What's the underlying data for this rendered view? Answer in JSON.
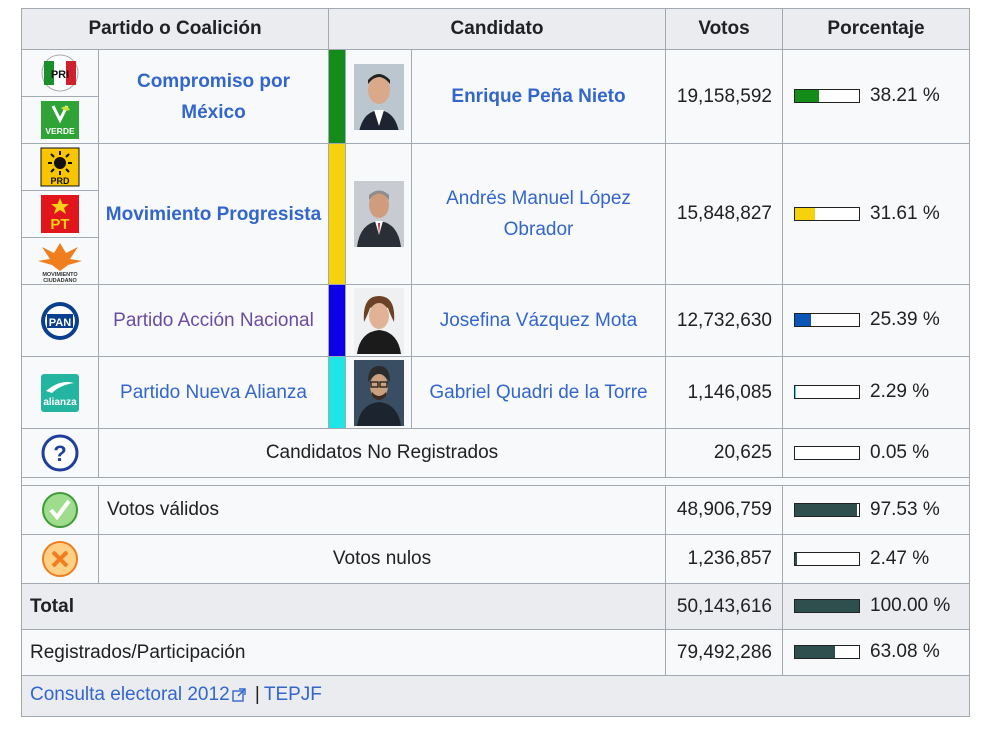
{
  "headers": {
    "party": "Partido o Coalición",
    "candidate": "Candidato",
    "votes": "Votos",
    "percentage": "Porcentaje"
  },
  "rows": [
    {
      "logos": [
        {
          "icon": "pri-logo-icon",
          "text": "PRI"
        },
        {
          "icon": "verde-logo-icon",
          "text": "VERDE"
        }
      ],
      "party": "Compromiso por México",
      "color": "#148c1a",
      "candidate": "Enrique Peña Nieto",
      "votes": "19,158,592",
      "percent_value": 38.21,
      "percent": "38.21 %"
    },
    {
      "logos": [
        {
          "icon": "prd-logo-icon",
          "text": "PRD"
        },
        {
          "icon": "pt-logo-icon",
          "text": "PT"
        },
        {
          "icon": "movimiento-ciudadano-logo-icon",
          "text": "MOVIMIENTO CIUDADANO"
        }
      ],
      "party": "Movimiento Progresista",
      "color": "#f5d20c",
      "candidate": "Andrés Manuel López Obrador",
      "votes": "15,848,827",
      "percent_value": 31.61,
      "percent": "31.61 %"
    },
    {
      "logos": [
        {
          "icon": "pan-logo-icon",
          "text": "PAN"
        }
      ],
      "party": "Partido Acción Nacional",
      "color": "#0b00e8",
      "candidate": "Josefina Vázquez Mota",
      "votes": "12,732,630",
      "percent_value": 25.39,
      "percent": "25.39 %"
    },
    {
      "logos": [
        {
          "icon": "nueva-alianza-logo-icon",
          "text": "alianza"
        }
      ],
      "party": "Partido Nueva Alianza",
      "color": "#1ee6e6",
      "candidate": "Gabriel Quadri de la Torre",
      "votes": "1,146,085",
      "percent_value": 2.29,
      "percent": "2.29 %"
    }
  ],
  "unregistered": {
    "icon": "question-icon",
    "label": "Candidatos No Registrados",
    "votes": "20,625",
    "percent_value": 0.05,
    "percent": "0.05 %"
  },
  "valid": {
    "icon": "check-icon",
    "label": "Votos válidos",
    "votes": "48,906,759",
    "percent_value": 97.53,
    "percent": "97.53 %"
  },
  "null_votes": {
    "icon": "x-icon",
    "label": "Votos nulos",
    "votes": "1,236,857",
    "percent_value": 2.47,
    "percent": "2.47 %"
  },
  "total": {
    "label": "Total",
    "votes": "50,143,616",
    "percent_value": 100,
    "percent": "100.00 %"
  },
  "registered": {
    "label": "Registrados/Participación",
    "votes": "79,492,286",
    "percent_value": 63.08,
    "percent": "63.08 %"
  },
  "footer": {
    "link1": "Consulta electoral 2012",
    "separator": "|",
    "link2": "TEPJF"
  },
  "colors": {
    "link": "#3366cc",
    "visited": "#6b4ba1",
    "summary_bar": "#2f4f4f",
    "pan_bar": "#0a56b8"
  }
}
